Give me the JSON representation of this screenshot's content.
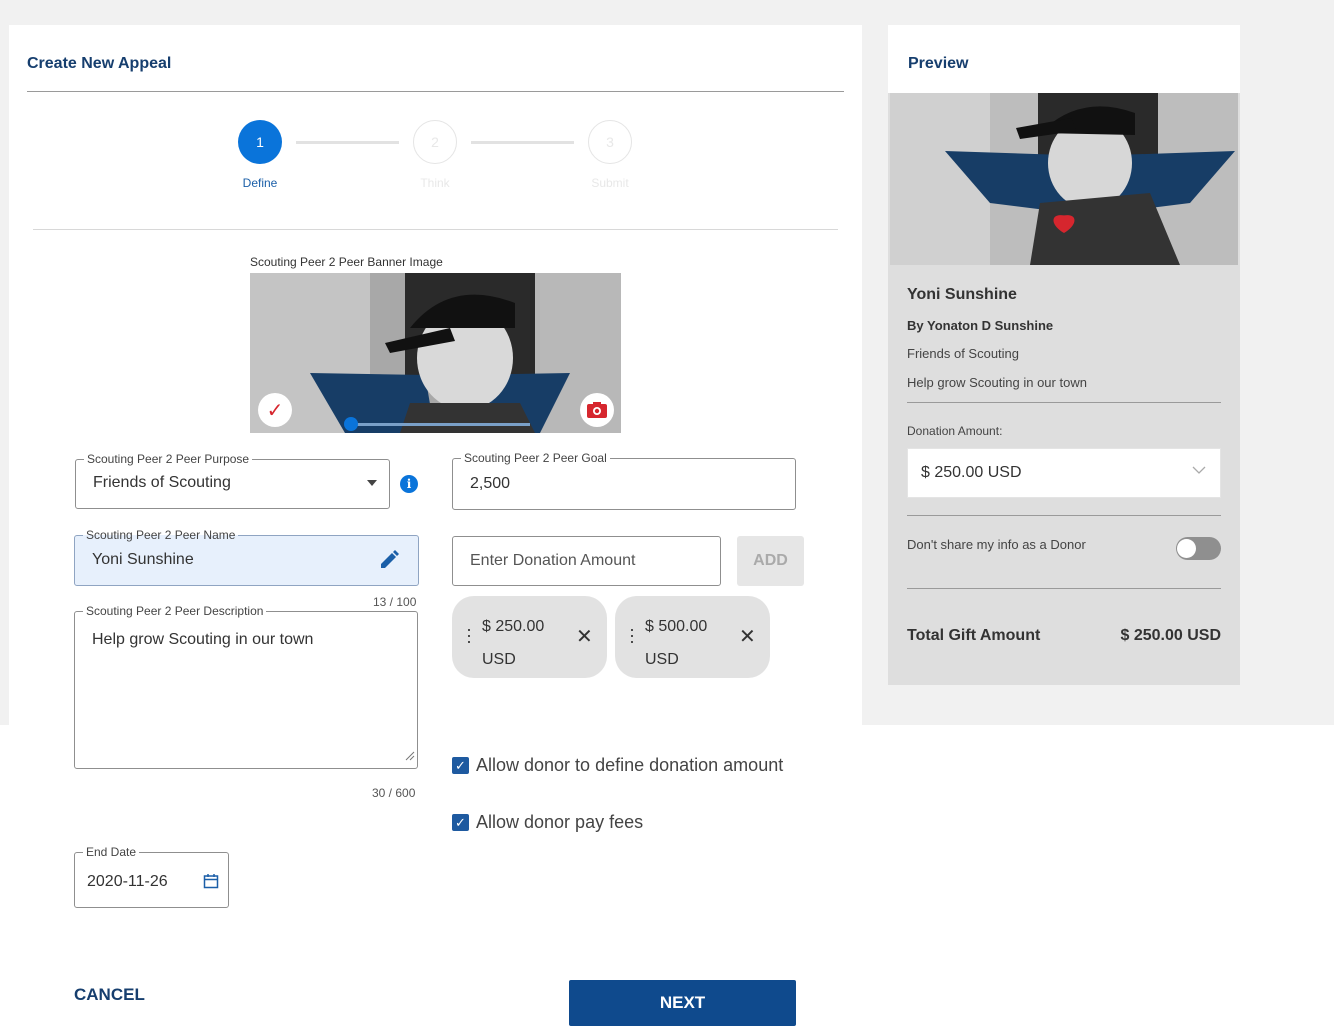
{
  "form": {
    "title": "Create New Appeal",
    "steps": [
      {
        "number": "1",
        "label": "Define",
        "state": "active"
      },
      {
        "number": "2",
        "label": "Think",
        "state": "inactive"
      },
      {
        "number": "3",
        "label": "Submit",
        "state": "inactive"
      }
    ],
    "banner_label": "Scouting Peer 2 Peer Banner Image",
    "purpose": {
      "label": "Scouting Peer 2 Peer Purpose",
      "value": "Friends of Scouting"
    },
    "goal": {
      "label": "Scouting Peer 2 Peer Goal",
      "value": "2,500"
    },
    "name": {
      "label": "Scouting Peer 2 Peer Name",
      "value": "Yoni Sunshine",
      "counter": "13 / 100"
    },
    "description": {
      "label": "Scouting Peer 2 Peer Description",
      "value": "Help grow Scouting in our town",
      "counter": "30 / 600"
    },
    "donation_input": {
      "placeholder": "Enter Donation Amount"
    },
    "add_label": "ADD",
    "chips": [
      {
        "amount": "$ 250.00",
        "currency": "USD"
      },
      {
        "amount": "$ 500.00",
        "currency": "USD"
      }
    ],
    "checkboxes": [
      {
        "label": "Allow donor to define donation amount",
        "checked": true
      },
      {
        "label": "Allow donor pay fees",
        "checked": true
      }
    ],
    "end_date": {
      "label": "End Date",
      "value": "2020-11-26"
    },
    "cancel_label": "CANCEL",
    "next_label": "NEXT"
  },
  "preview": {
    "title": "Preview",
    "name": "Yoni Sunshine",
    "by": "By Yonaton D Sunshine",
    "purpose": "Friends of Scouting",
    "description": "Help grow Scouting in our town",
    "donation_label": "Donation Amount:",
    "donation_value": "$ 250.00 USD",
    "share_label": "Don't share my info as a Donor",
    "total_label": "Total Gift Amount",
    "total_value": "$ 250.00 USD"
  },
  "colors": {
    "accent": "#0a74da",
    "brand": "#163e6e",
    "heart": "#d6262e"
  }
}
